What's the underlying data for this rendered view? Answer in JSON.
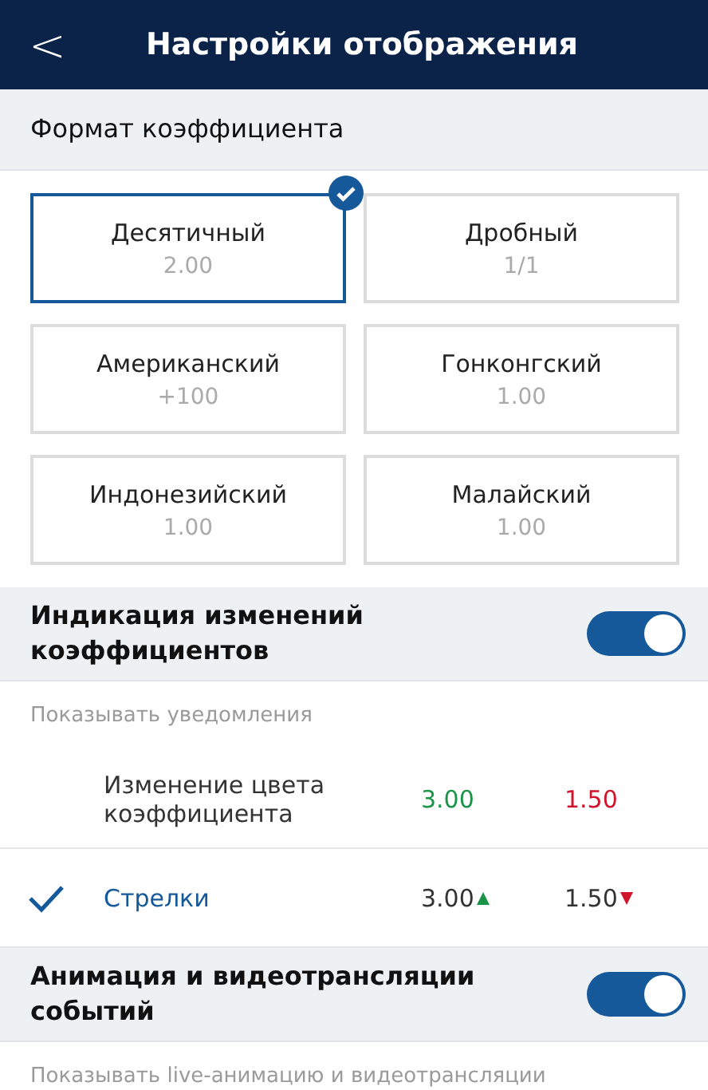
{
  "header": {
    "back": "<",
    "title": "Настройки отображения"
  },
  "odds_format": {
    "title": "Формат коэффициента",
    "options": [
      {
        "label": "Десятичный",
        "example": "2.00",
        "selected": true
      },
      {
        "label": "Дробный",
        "example": "1/1",
        "selected": false
      },
      {
        "label": "Американский",
        "example": "+100",
        "selected": false
      },
      {
        "label": "Гонконгский",
        "example": "1.00",
        "selected": false
      },
      {
        "label": "Индонезийский",
        "example": "1.00",
        "selected": false
      },
      {
        "label": "Малайский",
        "example": "1.00",
        "selected": false
      }
    ]
  },
  "odds_changes": {
    "title": "Индикация изменений коэффициентов",
    "on": true,
    "subtitle": "Показывать уведомления",
    "options": [
      {
        "kind": "color",
        "label": "Изменение цвета коэффициента",
        "up": "3.00",
        "down": "1.50",
        "selected": false
      },
      {
        "kind": "arrows",
        "label": "Стрелки",
        "up": "3.00",
        "down": "1.50",
        "selected": true
      }
    ]
  },
  "animation": {
    "title": "Анимация и видеотрансляции событий",
    "on": true,
    "subtitle": "Показывать live-анимацию и видеотрансляции"
  }
}
